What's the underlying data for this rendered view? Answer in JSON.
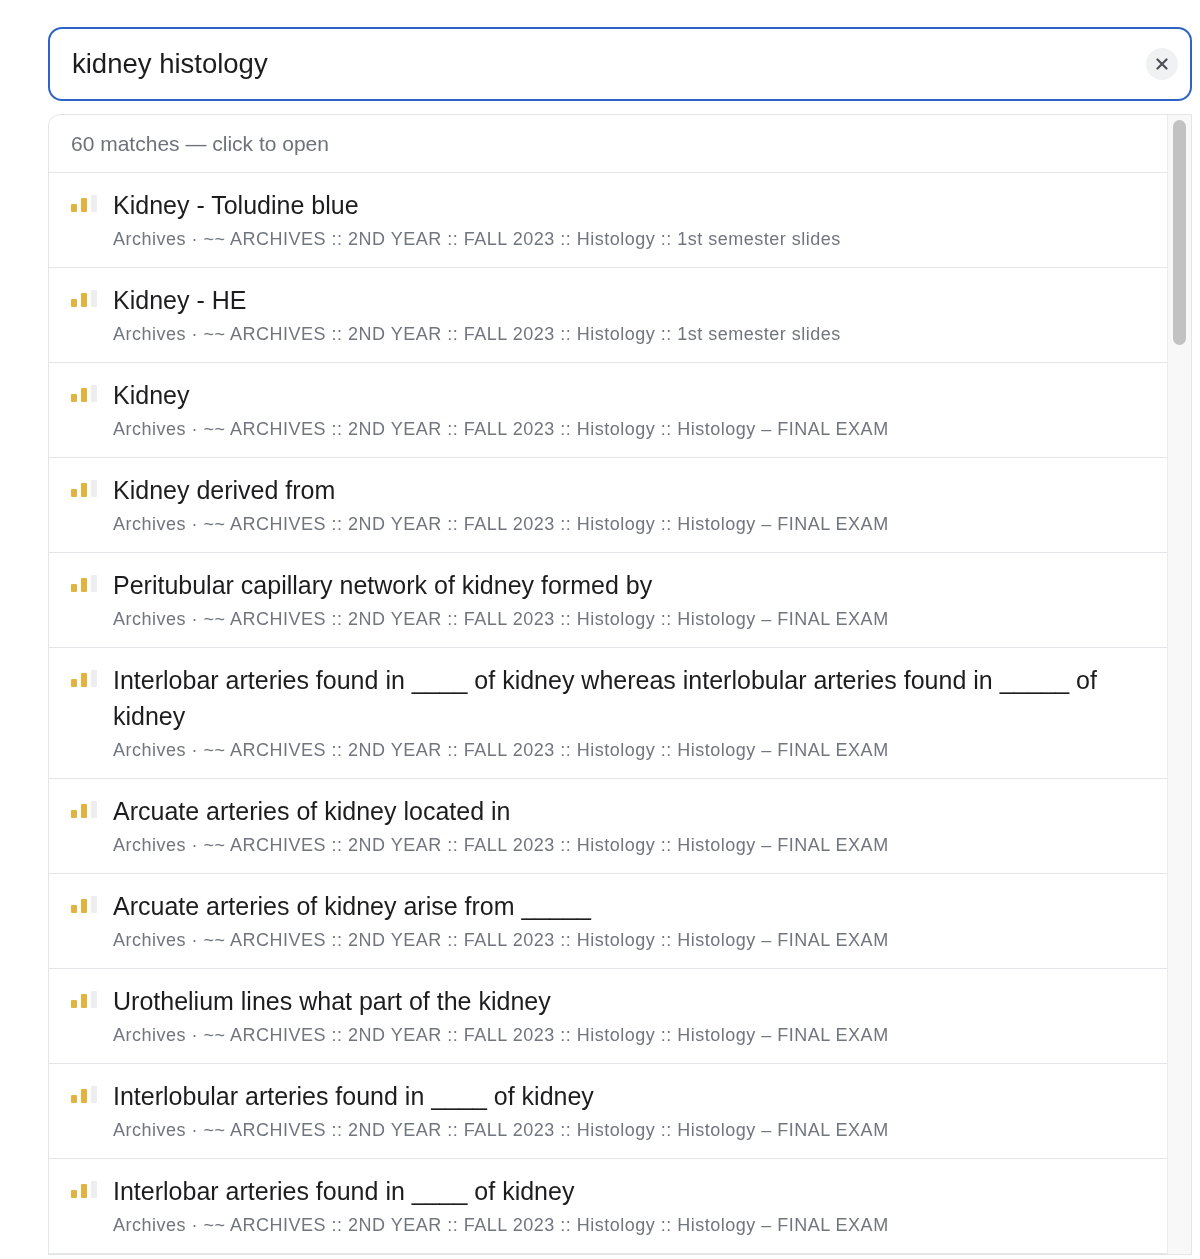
{
  "search": {
    "value": "kidney histology"
  },
  "results": {
    "summary": "60 matches — click to open",
    "items": [
      {
        "title": "Kidney - Toludine blue",
        "meta": "Archives · ~~ ARCHIVES :: 2ND YEAR :: FALL 2023 :: Histology :: 1st semester slides"
      },
      {
        "title": "Kidney - HE",
        "meta": "Archives · ~~ ARCHIVES :: 2ND YEAR :: FALL 2023 :: Histology :: 1st semester slides"
      },
      {
        "title": "Kidney",
        "meta": "Archives · ~~ ARCHIVES :: 2ND YEAR :: FALL 2023 :: Histology :: Histology – FINAL EXAM"
      },
      {
        "title": "Kidney derived from",
        "meta": "Archives · ~~ ARCHIVES :: 2ND YEAR :: FALL 2023 :: Histology :: Histology – FINAL EXAM"
      },
      {
        "title": "Peritubular capillary network of kidney formed by",
        "meta": "Archives · ~~ ARCHIVES :: 2ND YEAR :: FALL 2023 :: Histology :: Histology – FINAL EXAM"
      },
      {
        "title": "Interlobar arteries found in ____ of kidney whereas interlobular arteries found in _____ of kidney",
        "meta": "Archives · ~~ ARCHIVES :: 2ND YEAR :: FALL 2023 :: Histology :: Histology – FINAL EXAM"
      },
      {
        "title": "Arcuate arteries of kidney located in",
        "meta": "Archives · ~~ ARCHIVES :: 2ND YEAR :: FALL 2023 :: Histology :: Histology – FINAL EXAM"
      },
      {
        "title": "Arcuate arteries of kidney arise from _____",
        "meta": "Archives · ~~ ARCHIVES :: 2ND YEAR :: FALL 2023 :: Histology :: Histology – FINAL EXAM"
      },
      {
        "title": "Urothelium lines what part of the kidney",
        "meta": "Archives · ~~ ARCHIVES :: 2ND YEAR :: FALL 2023 :: Histology :: Histology – FINAL EXAM"
      },
      {
        "title": "Interlobular arteries found in ____ of kidney",
        "meta": "Archives · ~~ ARCHIVES :: 2ND YEAR :: FALL 2023 :: Histology :: Histology – FINAL EXAM"
      },
      {
        "title": "Interlobar arteries found in ____ of kidney",
        "meta": "Archives · ~~ ARCHIVES :: 2ND YEAR :: FALL 2023 :: Histology :: Histology – FINAL EXAM"
      }
    ]
  }
}
